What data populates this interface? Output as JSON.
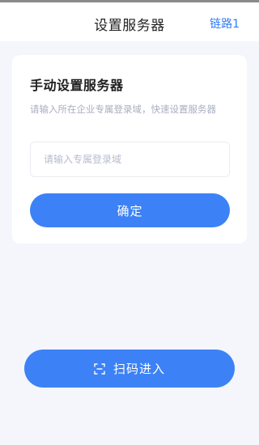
{
  "header": {
    "title": "设置服务器",
    "right_link": "链路1"
  },
  "card": {
    "title": "手动设置服务器",
    "description": "请输入所在企业专属登录域，快速设置服务器",
    "input_placeholder": "请输入专属登录域",
    "input_value": "",
    "confirm_label": "确定"
  },
  "scan": {
    "label": "扫码进入",
    "icon": "scan-icon"
  },
  "colors": {
    "accent": "#3c82f6",
    "link": "#2f7bf5",
    "background": "#f4f6fb"
  }
}
